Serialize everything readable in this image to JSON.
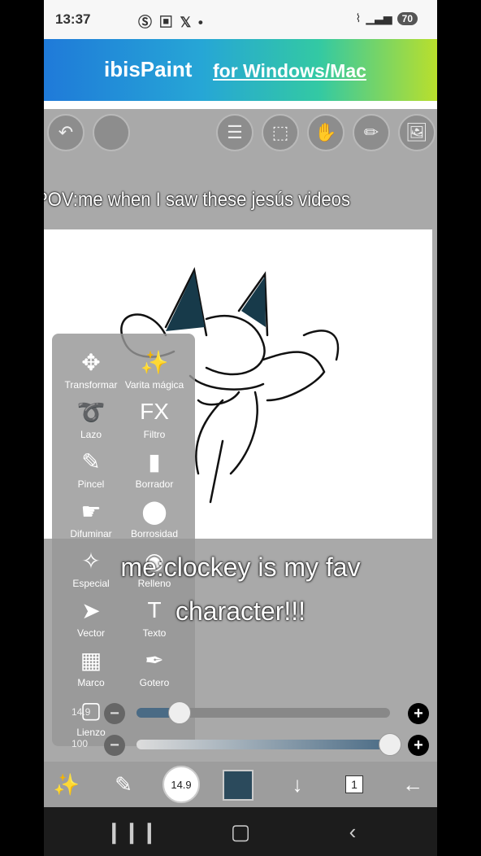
{
  "status_bar": {
    "time": "13:37",
    "app_icons": "Ⓢ ▣ 𝕏 •",
    "battery": "70"
  },
  "banner": {
    "logo": "ibisPaint",
    "promo": "for Windows/Mac"
  },
  "overlay": {
    "pov": "POV:me when I saw these jesús videos",
    "caption_line1": "me:clockey is my fav",
    "caption_line2": "character!!!"
  },
  "tools": [
    {
      "label": "Transformar",
      "icon": "move-icon",
      "glyph": "✥"
    },
    {
      "label": "Varita mágica",
      "icon": "magic-wand-icon",
      "glyph": "✨"
    },
    {
      "label": "Lazo",
      "icon": "lasso-icon",
      "glyph": "➰"
    },
    {
      "label": "Filtro",
      "icon": "fx-icon",
      "glyph": "FX"
    },
    {
      "label": "Pincel",
      "icon": "brush-icon",
      "glyph": "✎"
    },
    {
      "label": "Borrador",
      "icon": "eraser-icon",
      "glyph": "▮"
    },
    {
      "label": "Difuminar",
      "icon": "smudge-icon",
      "glyph": "☛"
    },
    {
      "label": "Borrosidad",
      "icon": "blur-drop-icon",
      "glyph": "⬤"
    },
    {
      "label": "Especial",
      "icon": "special-sparkle-icon",
      "glyph": "✧"
    },
    {
      "label": "Relleno",
      "icon": "fill-bucket-icon",
      "glyph": "◉"
    },
    {
      "label": "Vector",
      "icon": "vector-cursor-icon",
      "glyph": "➤"
    },
    {
      "label": "Texto",
      "icon": "text-icon",
      "glyph": "T"
    },
    {
      "label": "Marco",
      "icon": "frame-icon",
      "glyph": "▦"
    },
    {
      "label": "Gotero",
      "icon": "eyedropper-icon",
      "glyph": "✒"
    },
    {
      "label": "Lienzo",
      "icon": "canvas-icon",
      "glyph": "▢"
    }
  ],
  "brush_size": {
    "value": "14.9",
    "level": 0.17
  },
  "opacity": {
    "value": "100",
    "level": 1.0
  },
  "bottom_bar": {
    "brush_size_label": "14.9",
    "layer_count": "1",
    "color": "#2b4a5c"
  },
  "colors": {
    "panel": "#969696",
    "canvas": "#ffffff",
    "app_bg": "#a9a9a9"
  }
}
